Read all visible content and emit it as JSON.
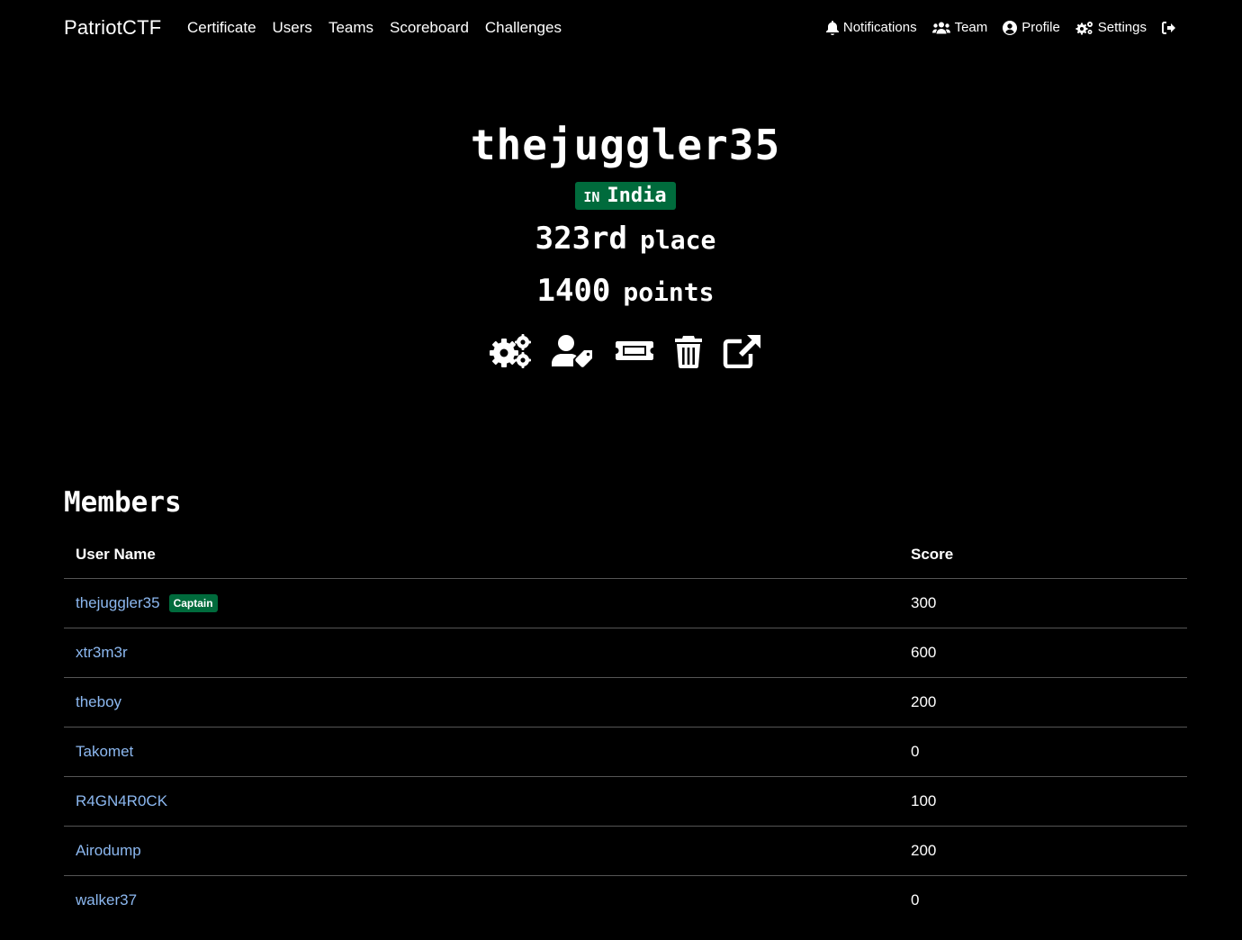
{
  "brand": "PatriotCTF",
  "nav": {
    "left": [
      "Certificate",
      "Users",
      "Teams",
      "Scoreboard",
      "Challenges"
    ],
    "notifications": "Notifications",
    "team": "Team",
    "profile": "Profile",
    "settings": "Settings",
    "logout_icon": "sign-out-icon"
  },
  "team": {
    "name": "thejuggler35",
    "country_code": "IN",
    "country": "India",
    "place_num": "323rd",
    "place_word": "place",
    "points_num": "1400",
    "points_word": "points"
  },
  "actions": [
    "settings-icon",
    "user-tag-icon",
    "ticket-icon",
    "trash-icon",
    "external-link-icon"
  ],
  "colors": {
    "background": "#000000",
    "badge_green": "#006b3c",
    "link_blue": "#8cb8f0"
  },
  "members": {
    "title": "Members",
    "headers": {
      "username": "User Name",
      "score": "Score"
    },
    "captain_label": "Captain",
    "rows": [
      {
        "name": "thejuggler35",
        "score": "300"
      },
      {
        "name": "xtr3m3r",
        "score": "600"
      },
      {
        "name": "theboy",
        "score": "200"
      },
      {
        "name": "Takomet",
        "score": "0"
      },
      {
        "name": "R4GN4R0CK",
        "score": "100"
      },
      {
        "name": "Airodump",
        "score": "200"
      },
      {
        "name": "walker37",
        "score": "0"
      }
    ]
  }
}
